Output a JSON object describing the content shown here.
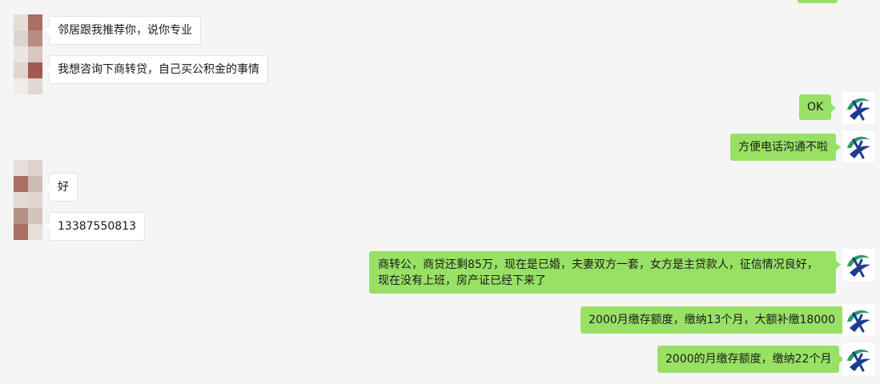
{
  "messages": {
    "m1": "邻居跟我推荐你，说你专业",
    "m2": "我想咨询下商转贷，自己买公积金的事情",
    "m3": "OK",
    "m4": "方便电话沟通不啦",
    "m5": "好",
    "m6": "13387550813",
    "m7": "商转公，商贷还剩85万，现在是已婚，夫妻双方一套，女方是主贷款人，征信情况良好，现在没有上班，房产证已经下来了",
    "m8": "2000月缴存额度，缴纳13个月，大额补缴18000",
    "m9": "2000的月缴存额度，缴纳22个月"
  },
  "colors": {
    "background": "#f5f5f5",
    "bubble_self": "#98e165",
    "bubble_other": "#ffffff",
    "logo_green": "#2e9a6a",
    "logo_blue": "#1d3b8f"
  },
  "icons": {
    "self_avatar": "green-blue-swoosh-logo",
    "other_avatar": "pixelated-avatar"
  }
}
